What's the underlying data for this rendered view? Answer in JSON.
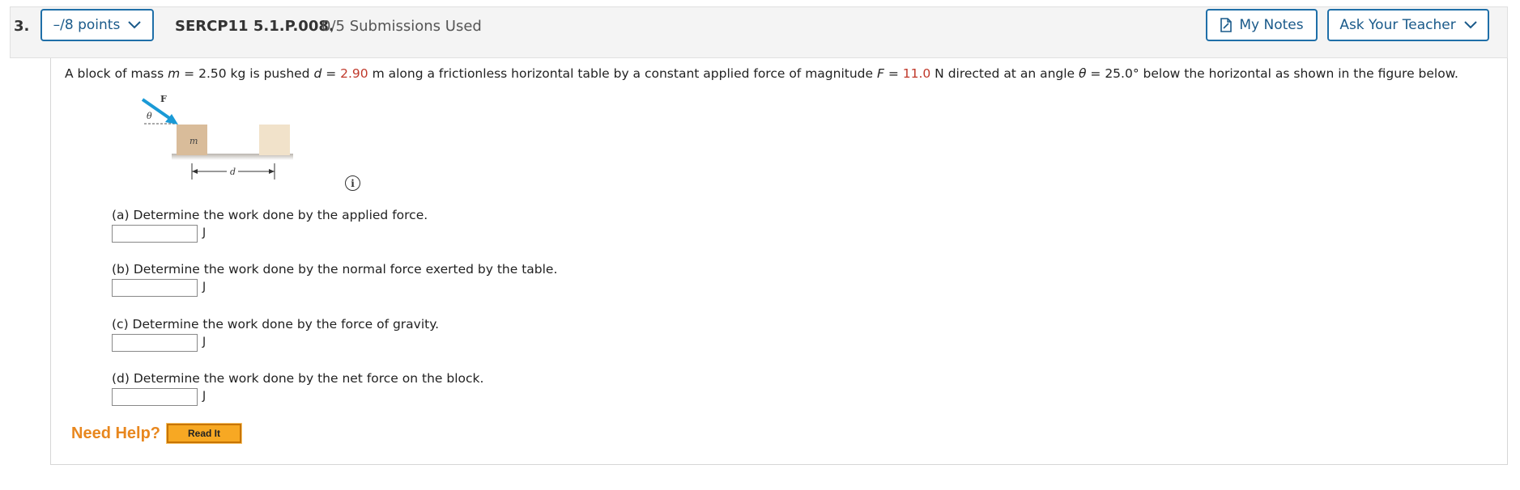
{
  "header": {
    "question_number": "3.",
    "points_label": "–/8 points",
    "question_id": "SERCP11 5.1.P.008.",
    "submissions": "0/5 Submissions Used",
    "my_notes_label": "My Notes",
    "ask_teacher_label": "Ask Your Teacher"
  },
  "problem": {
    "t1": "A block of mass ",
    "m_var": "m",
    "t2": " = 2.50 kg is pushed ",
    "d_var": "d",
    "t3": " = ",
    "d_value": "2.90",
    "t4": " m along a frictionless horizontal table by a constant applied force of magnitude ",
    "F_var": "F",
    "t5": " = ",
    "F_value": "11.0",
    "t6": " N directed at an angle ",
    "theta_var": "θ",
    "t7": " = 25.0° below the horizontal as shown in the figure below."
  },
  "figure": {
    "force_label": "F",
    "angle_label": "θ",
    "mass_label": "m",
    "distance_label": "d"
  },
  "info_icon": "i",
  "parts": [
    {
      "label": "(a) Determine the work done by the applied force.",
      "value": "",
      "unit": "J"
    },
    {
      "label": "(b) Determine the work done by the normal force exerted by the table.",
      "value": "",
      "unit": "J"
    },
    {
      "label": "(c) Determine the work done by the force of gravity.",
      "value": "",
      "unit": "J"
    },
    {
      "label": "(d) Determine the work done by the net force on the block.",
      "value": "",
      "unit": "J"
    }
  ],
  "help": {
    "need_help_label": "Need Help?",
    "read_it_label": "Read It"
  },
  "colors": {
    "accent": "#1f6fa8",
    "highlight_value": "#c0392b",
    "help_orange": "#e8871e",
    "button_orange": "#f7a823"
  }
}
